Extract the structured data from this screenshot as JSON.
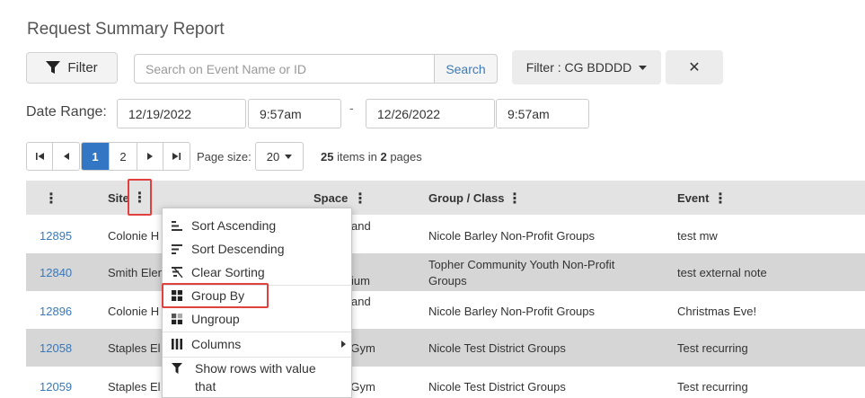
{
  "title": "Request Summary Report",
  "toolbar": {
    "filter_label": "Filter",
    "search_placeholder": "Search on Event Name or ID",
    "search_label": "Search",
    "cg_filter_label": "Filter : CG BDDDD",
    "close_glyph": "✕"
  },
  "date_range": {
    "label": "Date Range:",
    "start_date": "12/19/2022",
    "start_time": "9:57am",
    "separator": "-",
    "end_date": "12/26/2022",
    "end_time": "9:57am"
  },
  "pager": {
    "first": "⏮",
    "prev": "◀",
    "pages": [
      "1",
      "2"
    ],
    "next": "▶",
    "last": "⏭",
    "page_size_label": "Page size:",
    "page_size": "20",
    "items_count": "25",
    "items_mid": " items in ",
    "pages_count": "2",
    "items_end": " pages"
  },
  "table": {
    "headers": {
      "menu": "⋮",
      "site": "Site",
      "space": "Space",
      "group": "Group / Class",
      "event": "Event"
    },
    "rows": [
      {
        "id": "12895",
        "site": "Colonie H",
        "space": "and",
        "group": "Nicole Barley Non-Profit Groups",
        "event": "test mw"
      },
      {
        "id": "12840",
        "site": "Smith Elen",
        "space": "ium",
        "group": "Topher Community Youth Non-Profit Groups",
        "event": "test external note"
      },
      {
        "id": "12896",
        "site": "Colonie H",
        "space": "and",
        "group": "Nicole Barley Non-Profit Groups",
        "event": "Christmas Eve!"
      },
      {
        "id": "12058",
        "site": "Staples El",
        "space": "ll Gym",
        "group": "Nicole Test District Groups",
        "event": "Test recurring"
      },
      {
        "id": "12059",
        "site": "Staples El",
        "space": "ll Gym",
        "group": "Nicole Test District Groups",
        "event": "Test recurring"
      }
    ]
  },
  "column_menu": {
    "items": [
      {
        "label": "Sort Ascending",
        "icon": "sort-ascending-icon"
      },
      {
        "label": "Sort Descending",
        "icon": "sort-descending-icon"
      },
      {
        "label": "Clear Sorting",
        "icon": "clear-sorting-icon"
      },
      {
        "label": "Group By",
        "icon": "group-by-icon"
      },
      {
        "label": "Ungroup",
        "icon": "ungroup-icon"
      },
      {
        "label": "Columns",
        "icon": "columns-icon"
      },
      {
        "label": "Show rows with value that",
        "icon": "filter-icon"
      }
    ]
  },
  "colors": {
    "accent": "#3377c4",
    "link": "#3a78b8",
    "highlight": "#e04040",
    "row_alt": "#d6d6d6",
    "header_bg": "#e3e3e3"
  }
}
